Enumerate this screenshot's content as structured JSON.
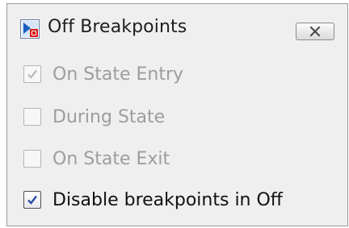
{
  "dialog": {
    "title": "Off Breakpoints",
    "icons": {
      "app": "stateflow-breakpoint-icon",
      "close": "close-icon"
    }
  },
  "options": [
    {
      "label": "On State Entry",
      "checked": true,
      "enabled": false
    },
    {
      "label": "During State",
      "checked": false,
      "enabled": false
    },
    {
      "label": "On State Exit",
      "checked": false,
      "enabled": false
    },
    {
      "label": "Disable breakpoints in Off",
      "checked": true,
      "enabled": true
    }
  ],
  "colors": {
    "panel_bg": "#efefef",
    "check_enabled": "#2b50a8",
    "check_disabled": "#b8b8b8",
    "text_disabled": "#9d9d9d"
  }
}
